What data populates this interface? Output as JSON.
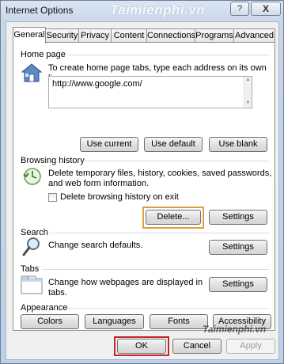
{
  "window": {
    "title": "Internet Options",
    "watermark": "Taimienphi.vn",
    "help_label": "?",
    "close_label": "X"
  },
  "tabs": [
    {
      "label": "General",
      "active": true
    },
    {
      "label": "Security"
    },
    {
      "label": "Privacy"
    },
    {
      "label": "Content"
    },
    {
      "label": "Connections"
    },
    {
      "label": "Programs"
    },
    {
      "label": "Advanced"
    }
  ],
  "home_page": {
    "label": "Home page",
    "description": "To create home page tabs, type each address on its own line.",
    "url": "http://www.google.com/",
    "buttons": {
      "use_current": "Use current",
      "use_default": "Use default",
      "use_blank": "Use blank"
    }
  },
  "browsing_history": {
    "label": "Browsing history",
    "description_line1": "Delete temporary files, history, cookies, saved passwords,",
    "description_line2": "and web form information.",
    "checkbox_label": "Delete browsing history on exit",
    "checkbox_checked": false,
    "delete_label": "Delete...",
    "settings_label": "Settings"
  },
  "search": {
    "label": "Search",
    "description": "Change search defaults.",
    "settings_label": "Settings"
  },
  "tabs_section": {
    "label": "Tabs",
    "description_line1": "Change how webpages are displayed in",
    "description_line2": "tabs.",
    "settings_label": "Settings"
  },
  "appearance": {
    "label": "Appearance",
    "buttons": {
      "colors": "Colors",
      "languages": "Languages",
      "fonts": "Fonts",
      "accessibility": "Accessibility"
    }
  },
  "footer": {
    "watermark": "Taimienphi.vn",
    "ok_label": "OK",
    "cancel_label": "Cancel",
    "apply_label": "Apply"
  },
  "colors": {
    "highlight_orange": "#d9a141",
    "highlight_red": "#c0272d"
  }
}
